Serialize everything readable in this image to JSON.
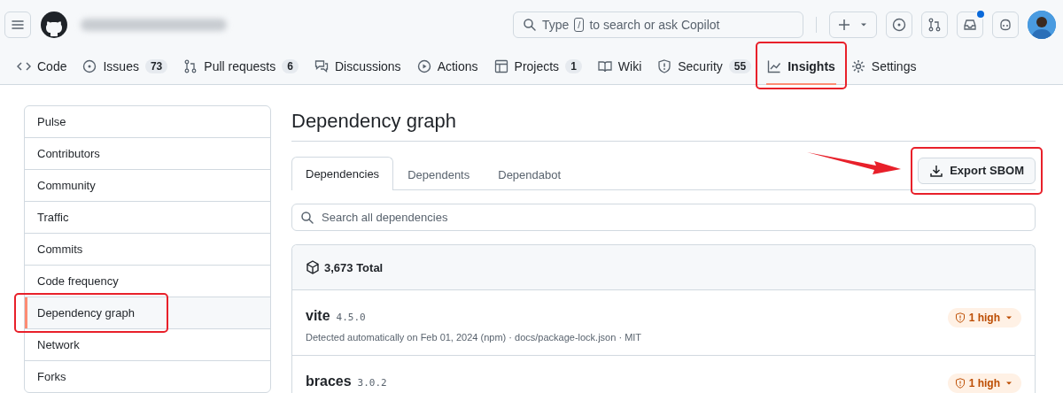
{
  "header": {
    "search": {
      "placeholder_before": "Type",
      "key": "/",
      "placeholder_after": "to search or ask Copilot"
    },
    "notification_dot": true
  },
  "repo_nav": [
    {
      "label": "Code",
      "selected": false,
      "highlighted": false
    },
    {
      "label": "Issues",
      "count": "73",
      "selected": false,
      "highlighted": false
    },
    {
      "label": "Pull requests",
      "count": "6",
      "selected": false,
      "highlighted": false
    },
    {
      "label": "Discussions",
      "selected": false,
      "highlighted": false
    },
    {
      "label": "Actions",
      "selected": false,
      "highlighted": false
    },
    {
      "label": "Projects",
      "count": "1",
      "selected": false,
      "highlighted": false
    },
    {
      "label": "Wiki",
      "selected": false,
      "highlighted": false
    },
    {
      "label": "Security",
      "count": "55",
      "selected": false,
      "highlighted": false
    },
    {
      "label": "Insights",
      "selected": true,
      "highlighted": true
    },
    {
      "label": "Settings",
      "selected": false,
      "highlighted": false
    }
  ],
  "sidebar": {
    "items": [
      {
        "label": "Pulse",
        "selected": false,
        "highlighted": false
      },
      {
        "label": "Contributors",
        "selected": false,
        "highlighted": false
      },
      {
        "label": "Community",
        "selected": false,
        "highlighted": false
      },
      {
        "label": "Traffic",
        "selected": false,
        "highlighted": false
      },
      {
        "label": "Commits",
        "selected": false,
        "highlighted": false
      },
      {
        "label": "Code frequency",
        "selected": false,
        "highlighted": false
      },
      {
        "label": "Dependency graph",
        "selected": true,
        "highlighted": true
      },
      {
        "label": "Network",
        "selected": false,
        "highlighted": false
      },
      {
        "label": "Forks",
        "selected": false,
        "highlighted": false
      }
    ]
  },
  "page_title": "Dependency graph",
  "tabs": [
    {
      "label": "Dependencies",
      "selected": true
    },
    {
      "label": "Dependents",
      "selected": false
    },
    {
      "label": "Dependabot",
      "selected": false
    }
  ],
  "export_button": {
    "label": "Export SBOM",
    "highlighted": true,
    "arrow": true
  },
  "dependency_search": {
    "placeholder": "Search all dependencies"
  },
  "total": "3,673 Total",
  "dependencies": [
    {
      "name": "vite",
      "version": "4.5.0",
      "detail": "Detected automatically on Feb 01, 2024 (npm) · docs/package-lock.json · MIT",
      "alert": "1 high"
    },
    {
      "name": "braces",
      "version": "3.0.2",
      "alert": "1 high"
    }
  ]
}
